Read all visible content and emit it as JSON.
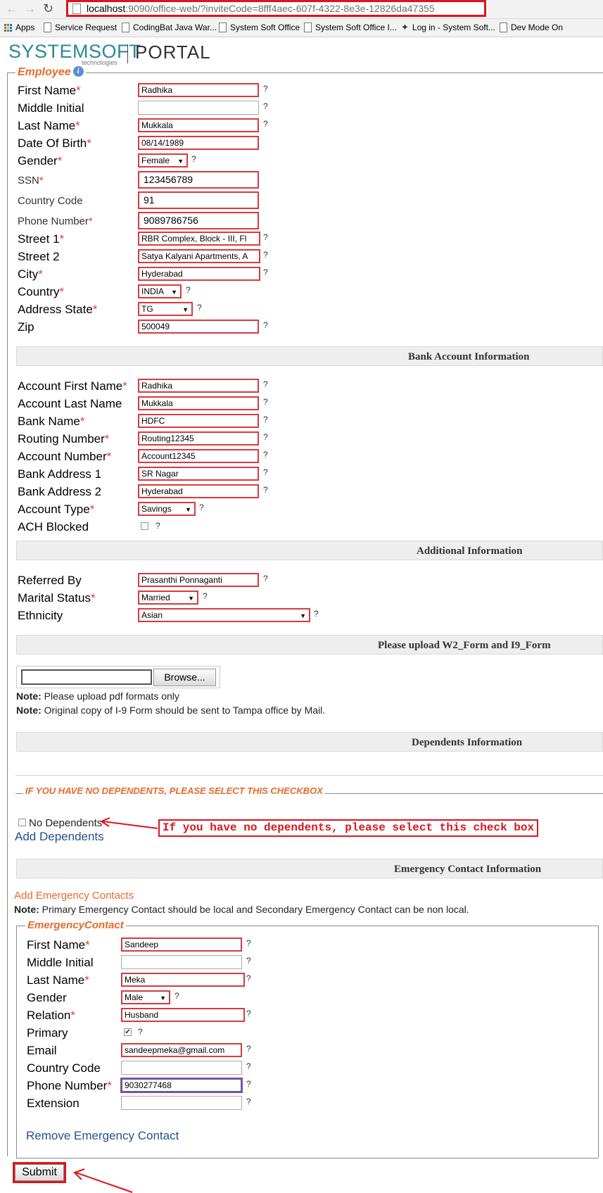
{
  "browser": {
    "url_host": "localhost",
    "url_rest": ":9090/office-web/?inviteCode=8fff4aec-607f-4322-8e3e-12826da47355",
    "bookmarks": [
      "Apps",
      "Service Request",
      "CodingBat Java War...",
      "System Soft Office",
      "System Soft Office I...",
      "Log in - System Soft...",
      "Dev Mode On"
    ]
  },
  "header": {
    "logo": "SYSTEMSOFT",
    "logo_sub": "technologies",
    "portal": "PORTAL"
  },
  "employee": {
    "legend": "Employee",
    "info_icon": "i",
    "fields": {
      "first_name": {
        "label": "First Name",
        "value": "Radhika"
      },
      "middle_initial": {
        "label": "Middle Initial",
        "value": ""
      },
      "last_name": {
        "label": "Last Name",
        "value": "Mukkala"
      },
      "dob": {
        "label": "Date Of Birth",
        "value": "08/14/1989"
      },
      "gender": {
        "label": "Gender",
        "value": "Female"
      },
      "ssn": {
        "label": "SSN",
        "value": "123456789"
      },
      "country_code": {
        "label": "Country Code",
        "value": "91"
      },
      "phone": {
        "label": "Phone Number",
        "value": "9089786756"
      },
      "street1": {
        "label": "Street 1",
        "value": "RBR Complex, Block - III, Fl"
      },
      "street2": {
        "label": "Street 2",
        "value": "Satya Kalyani Apartments, A"
      },
      "city": {
        "label": "City",
        "value": "Hyderabad"
      },
      "country": {
        "label": "Country",
        "value": "INDIA"
      },
      "state": {
        "label": "Address State",
        "value": "TG"
      },
      "zip": {
        "label": "Zip",
        "value": "500049"
      }
    }
  },
  "bank": {
    "title": "Bank Account Information",
    "fields": {
      "acct_first": {
        "label": "Account First Name",
        "value": "Radhika"
      },
      "acct_last": {
        "label": "Account Last Name",
        "value": "Mukkala"
      },
      "bank_name": {
        "label": "Bank Name",
        "value": "HDFC"
      },
      "routing": {
        "label": "Routing Number",
        "value": "Routing12345"
      },
      "acct_num": {
        "label": "Account Number",
        "value": "Account12345"
      },
      "addr1": {
        "label": "Bank Address 1",
        "value": "SR Nagar"
      },
      "addr2": {
        "label": "Bank Address 2",
        "value": "Hyderabad"
      },
      "acct_type": {
        "label": "Account Type",
        "value": "Savings"
      },
      "ach": {
        "label": "ACH Blocked"
      }
    }
  },
  "additional": {
    "title": "Additional Information",
    "fields": {
      "referred": {
        "label": "Referred By",
        "value": "Prasanthi Ponnaganti"
      },
      "marital": {
        "label": "Marital Status",
        "value": "Married"
      },
      "ethnicity": {
        "label": "Ethnicity",
        "value": "Asian"
      }
    }
  },
  "upload": {
    "title": "Please upload W2_Form and I9_Form",
    "browse": "Browse...",
    "note_label": "Note:",
    "note1": " Please upload pdf formats only",
    "note2": " Original copy of I-9 Form should be sent to Tampa office by Mail."
  },
  "dependents": {
    "title": "Dependents Information",
    "legend": "IF YOU HAVE NO DEPENDENTS, PLEASE SELECT THIS CHECKBOX",
    "no_dep": "No Dependents",
    "callout": "If you have no dependents, please select this check box",
    "add": "Add Dependents"
  },
  "emergency": {
    "title": "Emergency Contact Information",
    "add": "Add Emergency Contacts",
    "note_label": "Note:",
    "note": " Primary Emergency Contact should be local and Secondary Emergency Contact can be non local.",
    "legend": "EmergencyContact",
    "fields": {
      "first_name": {
        "label": "First Name",
        "value": "Sandeep"
      },
      "middle_initial": {
        "label": "Middle Initial",
        "value": ""
      },
      "last_name": {
        "label": "Last Name",
        "value": "Meka"
      },
      "gender": {
        "label": "Gender",
        "value": "Male"
      },
      "relation": {
        "label": "Relation",
        "value": "Husband"
      },
      "primary": {
        "label": "Primary",
        "checked": "✔"
      },
      "email": {
        "label": "Email",
        "value": "sandeepmeka@gmail.com"
      },
      "country_code": {
        "label": "Country Code",
        "value": ""
      },
      "phone": {
        "label": "Phone Number",
        "value": "9030277468"
      },
      "extension": {
        "label": "Extension",
        "value": ""
      }
    },
    "remove": "Remove Emergency Contact"
  },
  "submit": "Submit",
  "q": "?",
  "req": "*",
  "colors": {
    "accent": "#e66b2a",
    "error": "#d9393e",
    "link": "#23528f",
    "logo": "#2a8a96"
  }
}
